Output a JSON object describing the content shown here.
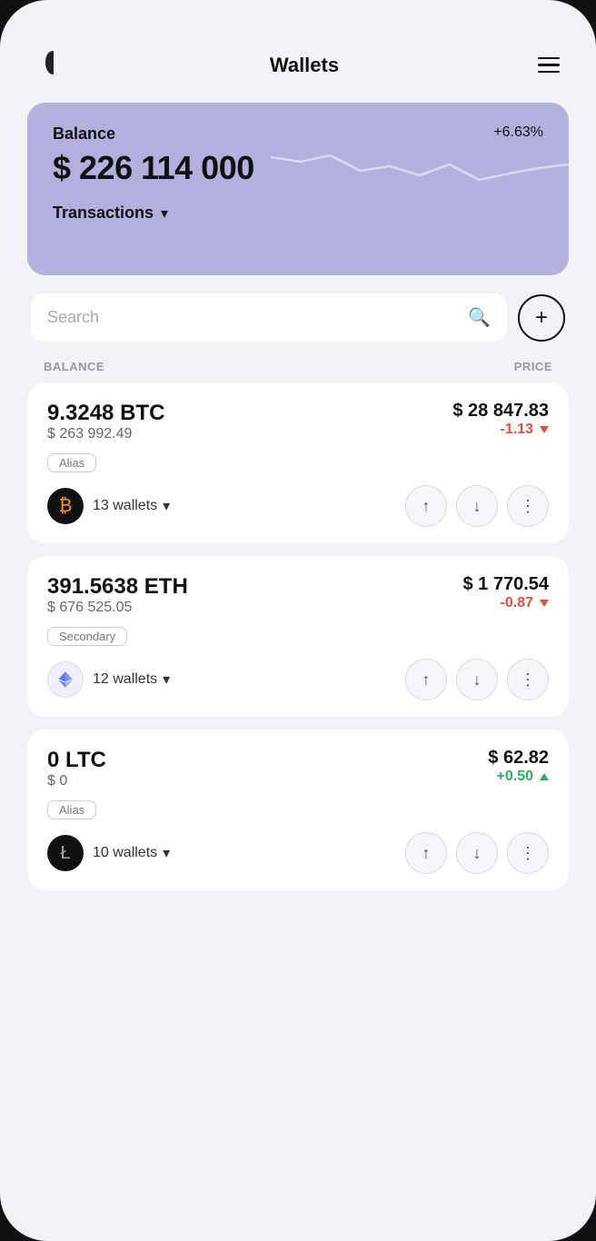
{
  "header": {
    "title": "Wallets",
    "menu_label": "menu"
  },
  "balance_card": {
    "label": "Balance",
    "change": "+6.63%",
    "amount": "$ 226 114 000",
    "transactions_label": "Transactions"
  },
  "search": {
    "placeholder": "Search"
  },
  "columns": {
    "balance": "BALANCE",
    "price": "PRICE"
  },
  "add_button_label": "+",
  "coins": [
    {
      "amount": "9.3248 BTC",
      "usd_value": "$ 263 992.49",
      "price": "$ 28 847.83",
      "change": "-1.13",
      "change_direction": "neg",
      "alias": "Alias",
      "wallets_count": "13 wallets",
      "logo_symbol": "₿",
      "logo_type": "btc"
    },
    {
      "amount": "391.5638 ETH",
      "usd_value": "$ 676 525.05",
      "price": "$ 1 770.54",
      "change": "-0.87",
      "change_direction": "neg",
      "alias": "Secondary",
      "wallets_count": "12 wallets",
      "logo_symbol": "⬡",
      "logo_type": "eth"
    },
    {
      "amount": "0 LTC",
      "usd_value": "$ 0",
      "price": "$ 62.82",
      "change": "+0.50",
      "change_direction": "pos",
      "alias": "Alias",
      "wallets_count": "10 wallets",
      "logo_symbol": "Ł",
      "logo_type": "ltc"
    }
  ]
}
